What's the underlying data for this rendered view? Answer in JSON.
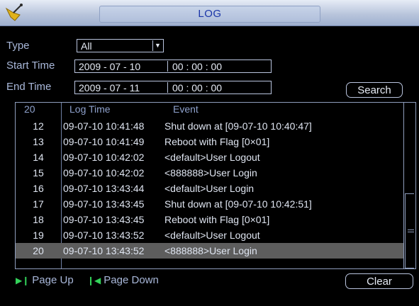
{
  "window": {
    "title": "LOG",
    "accent": "#1a35a8"
  },
  "filters": {
    "type_label": "Type",
    "type_value": "All",
    "start_label": "Start Time",
    "start_date": "2009  -  07  -  10",
    "start_time": "00  :  00  :  00",
    "end_label": "End Time",
    "end_date": "2009  -  07  -  11",
    "end_time": "00  :  00  :  00"
  },
  "buttons": {
    "search": "Search",
    "clear": "Clear"
  },
  "table": {
    "header_count": "20",
    "col_time": "Log Time",
    "col_event": "Event",
    "rows": [
      {
        "num": "12",
        "time": "09-07-10 10:41:48",
        "event": "Shut down at [09-07-10 10:40:47]"
      },
      {
        "num": "13",
        "time": "09-07-10 10:41:49",
        "event": "Reboot with Flag [0×01]"
      },
      {
        "num": "14",
        "time": "09-07-10 10:42:02",
        "event": "<default>User Logout"
      },
      {
        "num": "15",
        "time": "09-07-10 10:42:02",
        "event": "<888888>User Login"
      },
      {
        "num": "16",
        "time": "09-07-10 13:43:44",
        "event": "<default>User Login"
      },
      {
        "num": "17",
        "time": "09-07-10 13:43:45",
        "event": "Shut down at [09-07-10 10:42:51]"
      },
      {
        "num": "18",
        "time": "09-07-10 13:43:45",
        "event": "Reboot with Flag [0×01]"
      },
      {
        "num": "19",
        "time": "09-07-10 13:43:52",
        "event": "<default>User Logout"
      },
      {
        "num": "20",
        "time": "09-07-10 13:43:52",
        "event": "<888888>User Login"
      }
    ]
  },
  "pager": {
    "page_up": "Page Up",
    "page_down": "Page Down"
  },
  "icons": {
    "logo": "wrench-logo-icon",
    "page_up": "next-page-icon",
    "page_down": "previous-page-icon",
    "dropdown": "chevron-down-icon"
  }
}
